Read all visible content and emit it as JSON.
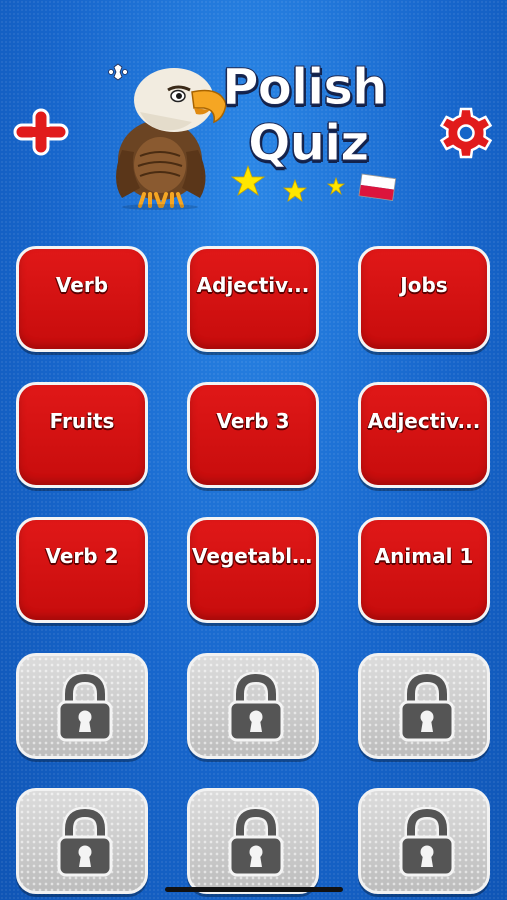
{
  "header": {
    "title_line1": "Polish",
    "title_line2": "Quiz"
  },
  "icons": {
    "add": "plus-icon",
    "settings": "gear-icon",
    "lock": "lock-icon"
  },
  "colors": {
    "background": "#1565c8",
    "tile_red": "#d81010",
    "tile_locked": "#c9c9c9",
    "accent": "#e11b1b"
  },
  "categories": [
    {
      "label": "Verb",
      "locked": false
    },
    {
      "label": "Adjectiv...",
      "locked": false
    },
    {
      "label": "Jobs",
      "locked": false
    },
    {
      "label": "Fruits",
      "locked": false
    },
    {
      "label": "Verb 3",
      "locked": false
    },
    {
      "label": "Adjectiv...",
      "locked": false
    },
    {
      "label": "Verb 2",
      "locked": false
    },
    {
      "label": "Vegetabl...",
      "locked": false
    },
    {
      "label": "Animal 1",
      "locked": false
    },
    {
      "label": "",
      "locked": true
    },
    {
      "label": "",
      "locked": true
    },
    {
      "label": "",
      "locked": true
    },
    {
      "label": "",
      "locked": true
    },
    {
      "label": "",
      "locked": true
    },
    {
      "label": "",
      "locked": true
    }
  ]
}
